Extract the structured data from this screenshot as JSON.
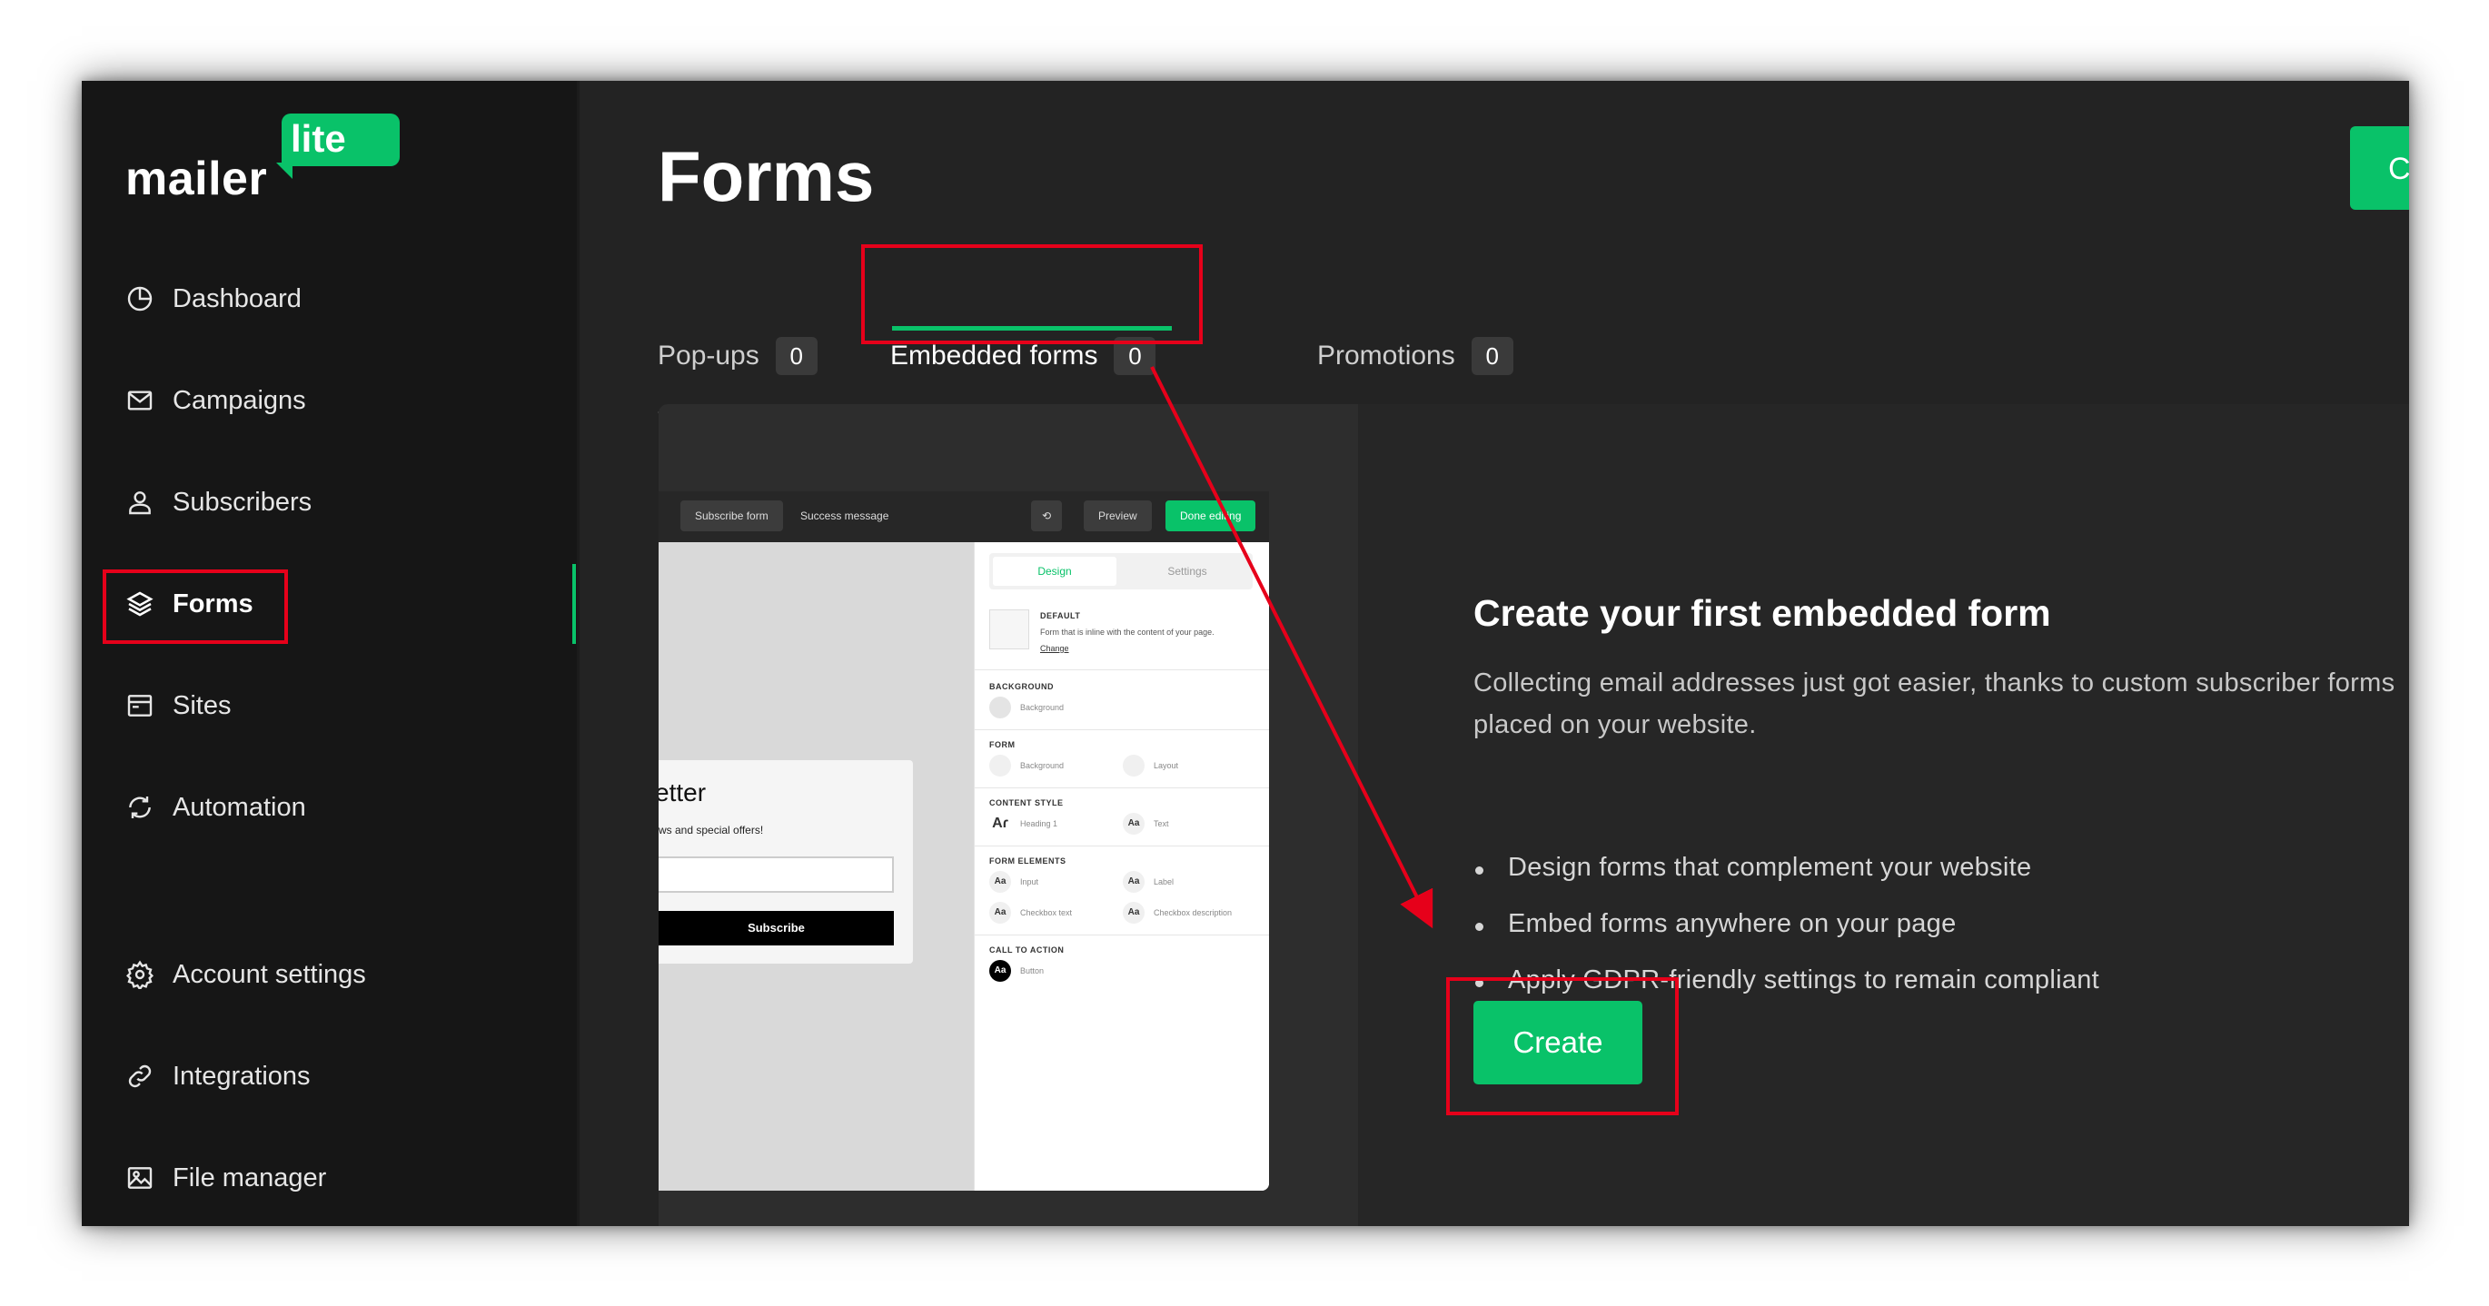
{
  "brand": {
    "word": "mailer",
    "badge": "lite"
  },
  "nav": {
    "dashboard": "Dashboard",
    "campaigns": "Campaigns",
    "subscribers": "Subscribers",
    "forms": "Forms",
    "sites": "Sites",
    "automation": "Automation",
    "account_settings": "Account settings",
    "integrations": "Integrations",
    "file_manager": "File manager"
  },
  "header": {
    "title": "Forms",
    "top_button": "C"
  },
  "tabs": [
    {
      "label": "Pop-ups",
      "count": "0"
    },
    {
      "label": "Embedded forms",
      "count": "0",
      "active": true
    },
    {
      "label": "Promotions",
      "count": "0"
    }
  ],
  "preview": {
    "toolbar": {
      "subscribe_form": "Subscribe form",
      "success_message": "Success message",
      "preview": "Preview",
      "done_editing": "Done editing"
    },
    "form": {
      "heading": "etter",
      "subheading": "ws and special offers!",
      "button": "Subscribe"
    },
    "panel": {
      "tab_design": "Design",
      "tab_settings": "Settings",
      "default_title": "DEFAULT",
      "default_desc": "Form that is inline with the content of your page.",
      "default_change": "Change",
      "background_title": "BACKGROUND",
      "background_item": "Background",
      "form_title": "FORM",
      "form_background": "Background",
      "form_layout": "Layout",
      "content_style_title": "CONTENT STYLE",
      "heading_item": "Heading 1",
      "text_item": "Text",
      "form_elements_title": "FORM ELEMENTS",
      "input_item": "Input",
      "label_item": "Label",
      "checkbox_text": "Checkbox text",
      "checkbox_desc": "Checkbox description",
      "cta_title": "CALL TO ACTION",
      "button_item": "Button",
      "aa": "Aa"
    }
  },
  "empty_state": {
    "title": "Create your first embedded form",
    "description": "Collecting email addresses just got easier, thanks to custom subscriber forms placed on your website.",
    "bullets": [
      "Design forms that complement your website",
      "Embed forms anywhere on your page",
      "Apply GDPR-friendly settings to remain compliant"
    ],
    "create_button": "Create"
  },
  "colors": {
    "accent": "#09c269",
    "annotation": "#e6001a",
    "sidebar": "#161616",
    "main": "#232323"
  }
}
